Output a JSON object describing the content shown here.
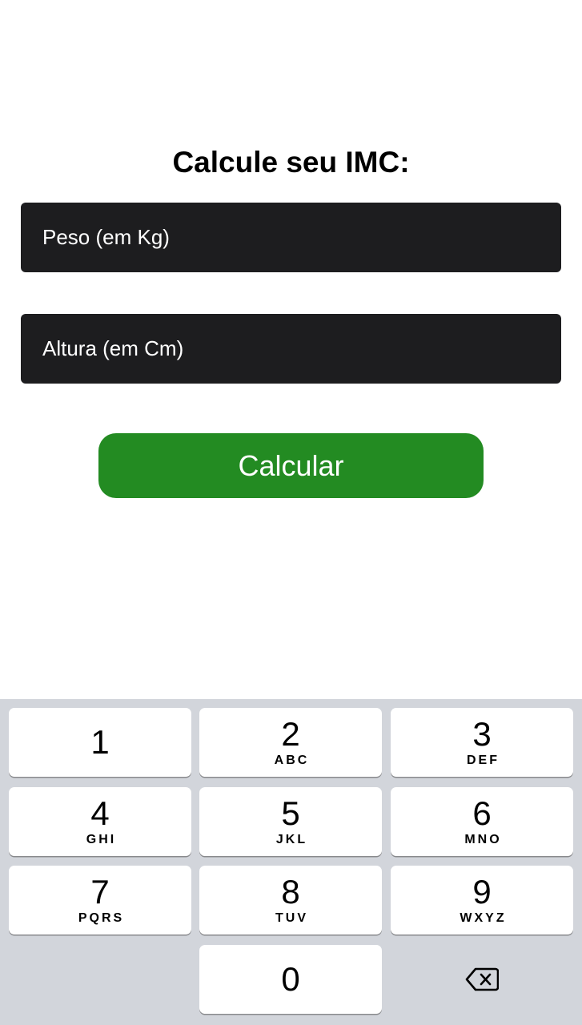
{
  "title": "Calcule seu IMC:",
  "form": {
    "peso_placeholder": "Peso (em Kg)",
    "peso_value": "",
    "altura_placeholder": "Altura (em Cm)",
    "altura_value": "",
    "calcular_label": "Calcular"
  },
  "keyboard": {
    "keys": [
      {
        "num": "1",
        "letters": ""
      },
      {
        "num": "2",
        "letters": "ABC"
      },
      {
        "num": "3",
        "letters": "DEF"
      },
      {
        "num": "4",
        "letters": "GHI"
      },
      {
        "num": "5",
        "letters": "JKL"
      },
      {
        "num": "6",
        "letters": "MNO"
      },
      {
        "num": "7",
        "letters": "PQRS"
      },
      {
        "num": "8",
        "letters": "TUV"
      },
      {
        "num": "9",
        "letters": "WXYZ"
      },
      {
        "num": "0",
        "letters": ""
      }
    ],
    "backspace_icon": "backspace-icon"
  },
  "colors": {
    "field_bg": "#1d1d1f",
    "button_bg": "#238b22",
    "keyboard_bg": "#d2d5db"
  }
}
